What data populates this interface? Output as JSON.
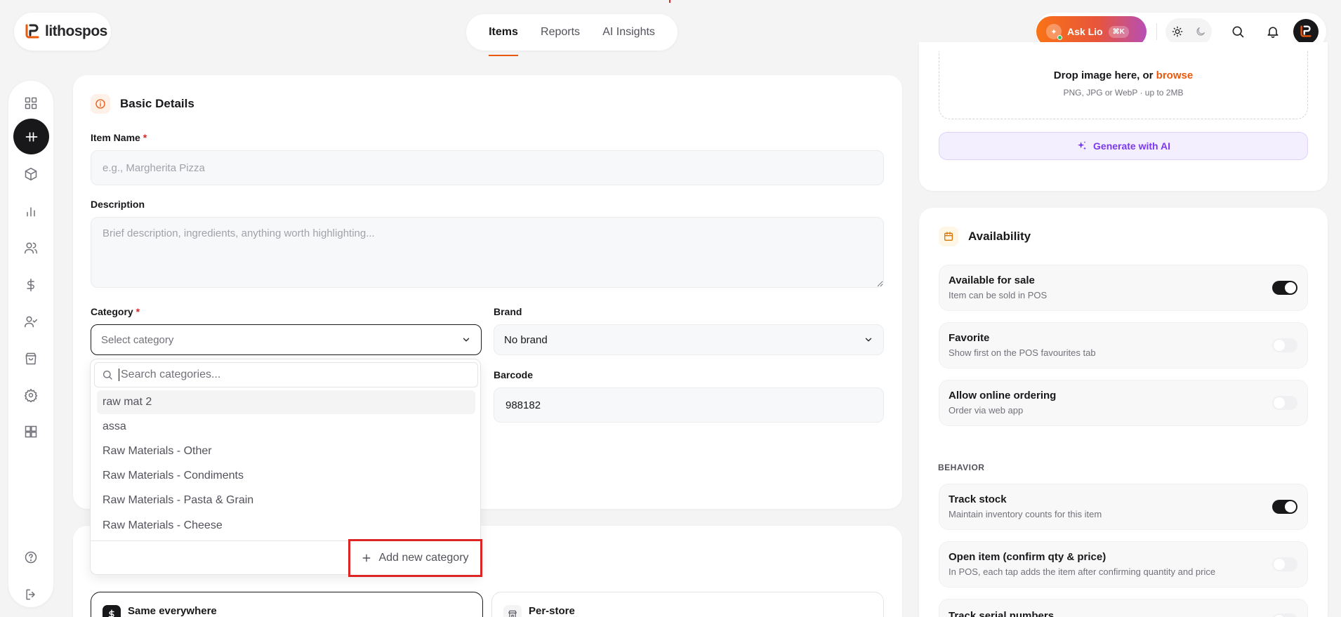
{
  "brand": {
    "name": "lithospos"
  },
  "top_tabs": [
    {
      "label": "Items",
      "active": true
    },
    {
      "label": "Reports",
      "active": false
    },
    {
      "label": "AI Insights",
      "active": false
    }
  ],
  "header": {
    "ask_label": "Ask Lio",
    "ask_shortcut": "⌘K"
  },
  "sidebar": {
    "items": [
      "dashboard-grid-icon",
      "pos-terminal-icon",
      "box-icon",
      "bar-chart-icon",
      "users-icon",
      "dollar-icon",
      "user-check-icon",
      "shopping-bag-icon",
      "gear-icon",
      "apps-grid-icon"
    ],
    "bottom": [
      "help-icon",
      "logout-icon"
    ]
  },
  "basic_details": {
    "title": "Basic Details",
    "item_name_label": "Item Name",
    "item_name_placeholder": "e.g., Margherita Pizza",
    "item_name_value": "",
    "description_label": "Description",
    "description_placeholder": "Brief description, ingredients, anything worth highlighting...",
    "category_label": "Category",
    "category_placeholder": "Select category",
    "brand_label": "Brand",
    "brand_value": "No brand",
    "barcode_label": "Barcode",
    "barcode_value": "988182",
    "required_mark": "*"
  },
  "category_dropdown": {
    "search_placeholder": "Search categories...",
    "options": [
      "raw mat 2",
      "assa",
      "Raw Materials - Other",
      "Raw Materials - Condiments",
      "Raw Materials - Pasta & Grain",
      "Raw Materials - Cheese"
    ],
    "add_new_label": "Add new category"
  },
  "pricing_scope": {
    "options": [
      {
        "label": "Same everywhere",
        "icon": "dollar-icon",
        "selected": true
      },
      {
        "label": "Per-store",
        "icon": "store-icon",
        "selected": false
      }
    ]
  },
  "image": {
    "drop_text": "Drop image here, or",
    "browse_text": "browse",
    "hint": "PNG, JPG or WebP · up to 2MB",
    "generate_label": "Generate with AI"
  },
  "availability": {
    "title": "Availability",
    "rows": [
      {
        "title": "Available for sale",
        "subtitle": "Item can be sold in POS",
        "on": true
      },
      {
        "title": "Favorite",
        "subtitle": "Show first on the POS favourites tab",
        "on": false
      },
      {
        "title": "Allow online ordering",
        "subtitle": "Order via web app",
        "on": false
      }
    ],
    "behavior_label": "BEHAVIOR",
    "behavior_rows": [
      {
        "title": "Track stock",
        "subtitle": "Maintain inventory counts for this item",
        "on": true
      },
      {
        "title": "Open item (confirm qty & price)",
        "subtitle": "In POS, each tap adds the item after confirming quantity and price",
        "on": false
      },
      {
        "title": "Track serial numbers",
        "subtitle": "",
        "on": false
      }
    ]
  },
  "colors": {
    "accent": "#ea580c",
    "dark": "#18181b",
    "ai_purple": "#7c3aed",
    "highlight_red": "#dc2626"
  }
}
